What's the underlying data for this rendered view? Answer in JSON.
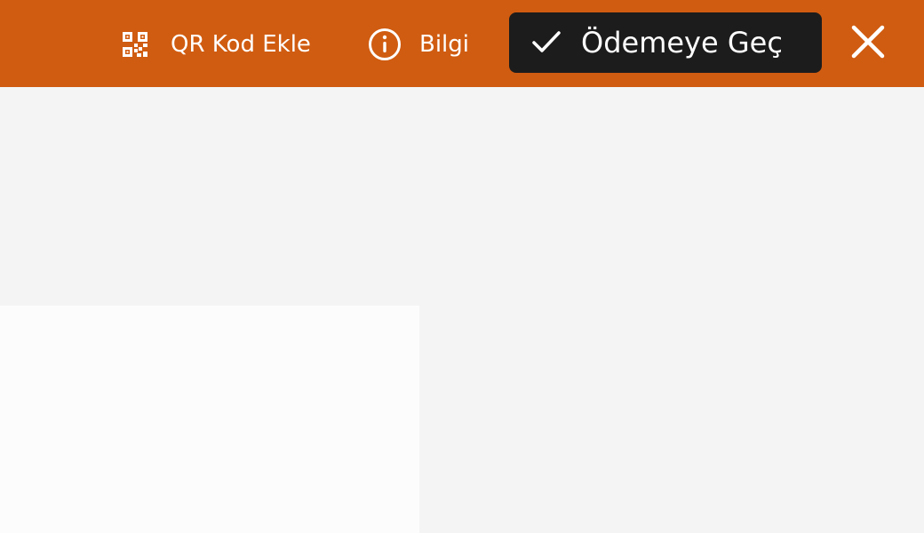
{
  "header": {
    "background_color": "#d05c11",
    "qr_action": {
      "icon": "qr-code-icon",
      "label": "QR Kod Ekle"
    },
    "info_action": {
      "icon": "info-circle-icon",
      "label": "Bilgi"
    },
    "checkout_button": {
      "icon": "checkmark-icon",
      "label": "Ödemeye Geç",
      "background_color": "#1c1c1c"
    },
    "close_button": {
      "icon": "close-icon"
    }
  },
  "content": {
    "background_color": "#f4f4f4",
    "panel_color": "#fcfcfc"
  }
}
